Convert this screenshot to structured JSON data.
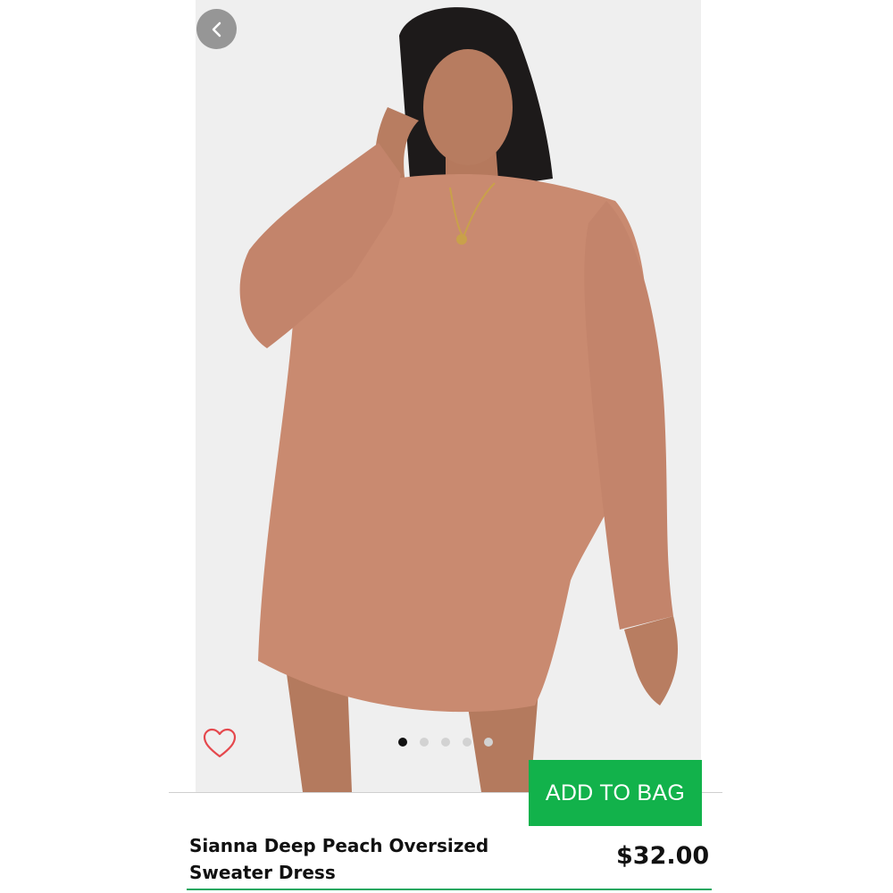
{
  "product": {
    "title_line1": "Sianna Deep Peach Oversized",
    "title_line2": "Sweater Dress",
    "price": "$32.00"
  },
  "actions": {
    "add_to_bag_label": "ADD TO BAG",
    "back_icon": "chevron-left-icon",
    "favorite_icon": "heart-outline-icon"
  },
  "carousel": {
    "total_images": 5,
    "current_index": 1
  },
  "colors": {
    "accent_green": "#12b24b",
    "favorite_red": "#e5484d",
    "dress": "#c98a70"
  }
}
